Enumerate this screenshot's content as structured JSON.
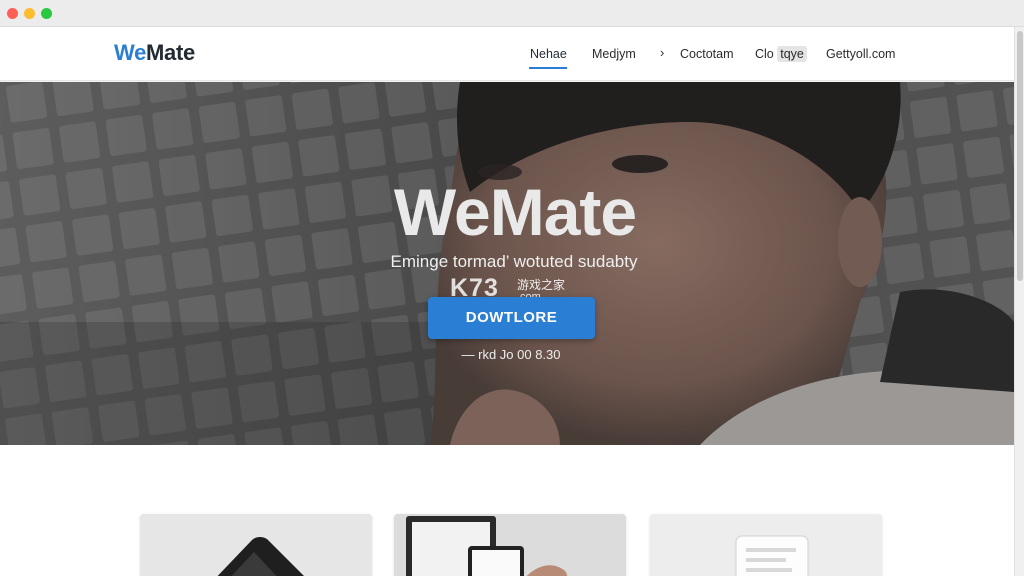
{
  "window": {
    "controls": [
      "close",
      "minimize",
      "maximize"
    ]
  },
  "header": {
    "logo_we": "We",
    "logo_mate": "Mate",
    "nav": [
      {
        "label": "Nehae",
        "active": true
      },
      {
        "label": "Medjym",
        "active": false
      },
      {
        "label": "Coctotam",
        "active": false
      },
      {
        "label_pre": "Clo",
        "label_badge": "tqye",
        "active": false
      },
      {
        "label": "Gettyoll.com",
        "active": false
      }
    ],
    "chevron_icon": "chevron-right-icon"
  },
  "hero": {
    "title": "WeMate",
    "subtitle": "Eminge tormad’ wotuted sudabty",
    "watermark": {
      "brand": "K73",
      "cn": "游戏之家",
      "domain": ".com"
    },
    "cta_label": "DOWTLORE",
    "version_text": "— rkd Jo 00 8.30"
  },
  "colors": {
    "accent": "#2a7fd4",
    "logo_dark": "#222a33"
  }
}
